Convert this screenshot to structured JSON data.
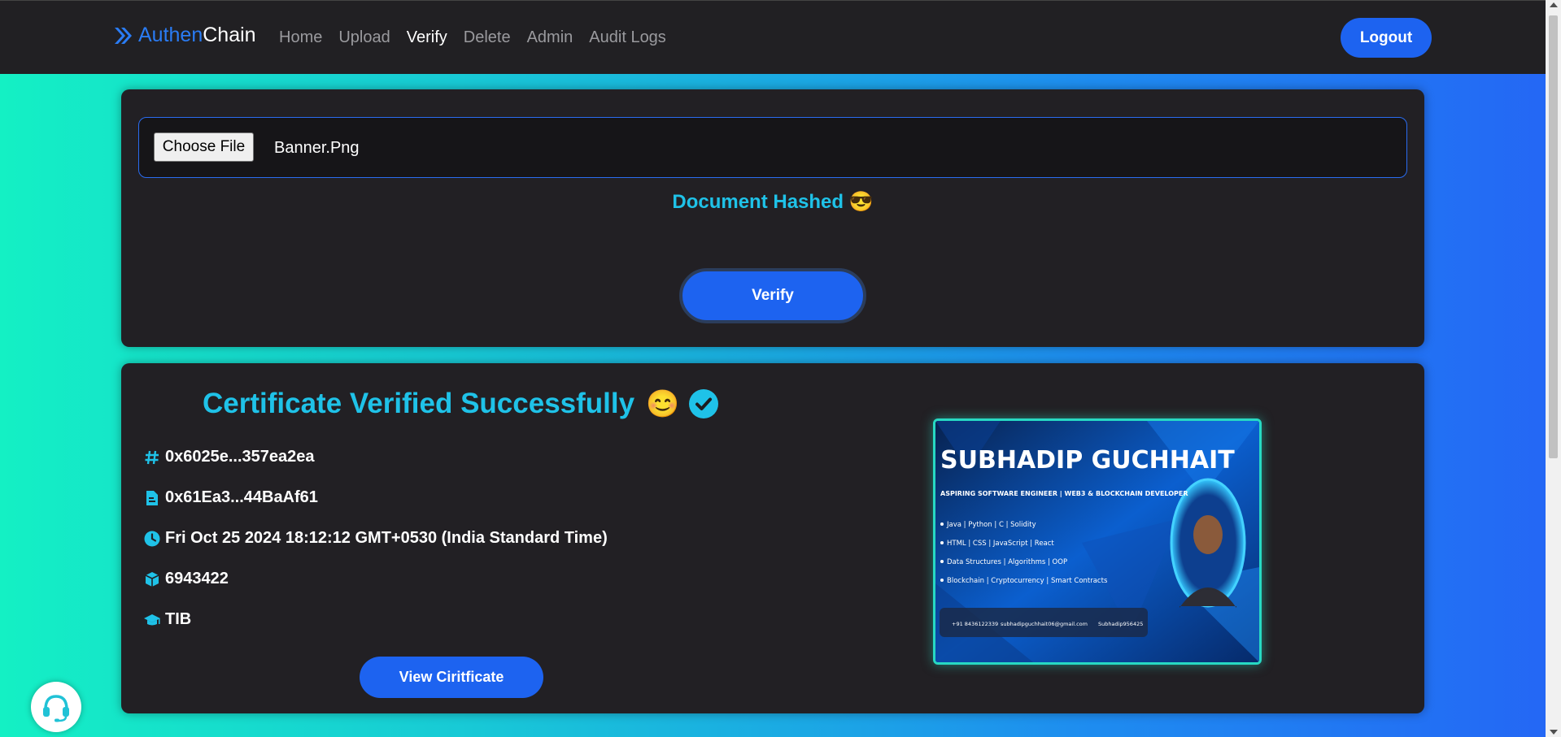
{
  "brand": {
    "part1": "Authen",
    "part2": "Chain"
  },
  "nav": {
    "items": [
      {
        "label": "Home"
      },
      {
        "label": "Upload"
      },
      {
        "label": "Verify"
      },
      {
        "label": "Delete"
      },
      {
        "label": "Admin"
      },
      {
        "label": "Audit Logs"
      }
    ],
    "active": "Verify",
    "logout_label": "Logout"
  },
  "upload": {
    "file_button_label": "Choose File",
    "file_name": "Banner.Png",
    "status": "Document Hashed 😎",
    "verify_label": "Verify"
  },
  "result": {
    "title": "Certificate Verified Successfully",
    "title_emoji": "😊",
    "hash": "0x6025e...357ea2ea",
    "issuer": "0x61Ea3...44BaAf61",
    "timestamp": "Fri Oct 25 2024 18:12:12 GMT+0530 (India Standard Time)",
    "block": "6943422",
    "institute": "TIB",
    "view_label": "View Ciritficate"
  },
  "certificate": {
    "name": "SUBHADIP GUCHHAIT",
    "tagline": "ASPIRING SOFTWARE ENGINEER | WEB3 & BLOCKCHAIN DEVELOPER",
    "skills": [
      "Java | Python | C | Solidity",
      "HTML | CSS | JavaScript | React",
      "Data Structures | Algorithms | OOP",
      "Blockchain | Cryptocurrency | Smart Contracts"
    ],
    "phone": "+91 8436122339",
    "email": "subhadipguchhait06@gmail.com",
    "handle": "Subhadip956425"
  },
  "colors": {
    "accent": "#1d63f0",
    "title": "#1fc2e8",
    "card": "#222024",
    "navbar": "#212023"
  },
  "icons": [
    "brand-chevron-icon",
    "hash-icon",
    "file-icon",
    "clock-icon",
    "cube-icon",
    "graduation-cap-icon",
    "check-circle-icon",
    "headset-icon"
  ]
}
